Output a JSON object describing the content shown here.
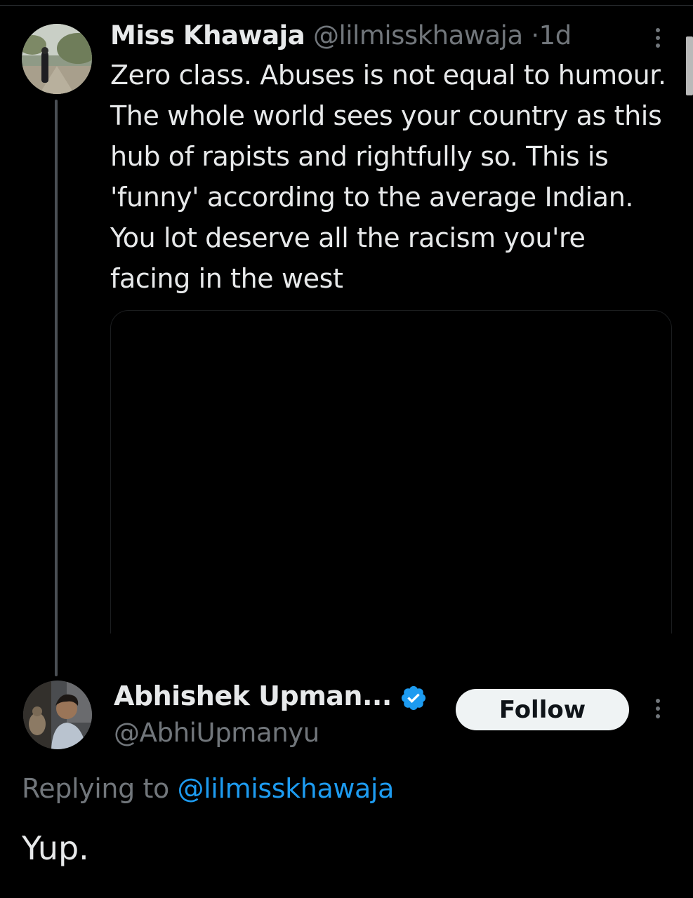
{
  "parent_tweet": {
    "author_name": "Miss Khawaja",
    "author_handle": "@lilmisskhawaja",
    "separator": "·",
    "time": "1d",
    "text": "Zero class. Abuses is not equal to humour. The whole world sees your country as this hub of rapists and rightfully so. This is 'funny' according to the average Indian. You lot deserve all the racism you're facing in the west",
    "avatar_icon": "profile-photo-woman-in-park"
  },
  "reply_tweet": {
    "author_name": "Abhishek Upman...",
    "verified": true,
    "verified_color": "#1d9bf0",
    "author_handle": "@AbhiUpmanyu",
    "follow_label": "Follow",
    "replying_prefix": "Replying to",
    "replying_to": "@lilmisskhawaja",
    "text": "Yup.",
    "avatar_icon": "profile-photo-man-with-cat"
  },
  "colors": {
    "background": "#000000",
    "primary_text": "#e7e9ea",
    "secondary_text": "#71767b",
    "link": "#1d9bf0",
    "button_bg": "#eff3f4"
  },
  "icons": [
    "more-options-icon",
    "verified-badge-icon"
  ]
}
